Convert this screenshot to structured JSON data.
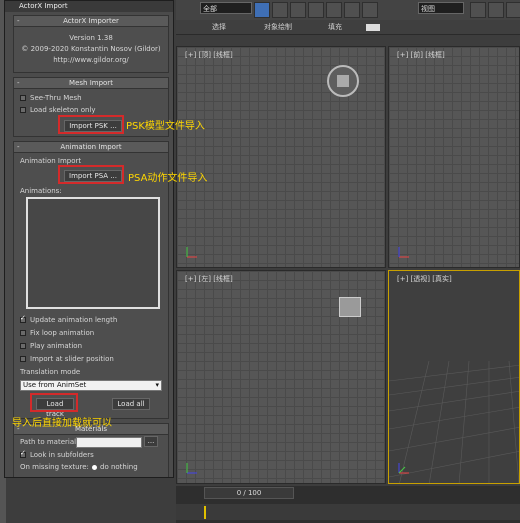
{
  "toolbar": {
    "filter_value": "全部",
    "view_value": "视图"
  },
  "subbar": {
    "tabs": [
      "选择",
      "对象绘制",
      "填充"
    ]
  },
  "viewports": {
    "top": "[+] [顶] [线框]",
    "front": "[+] [前] [线框]",
    "left": "[+] [左] [线框]",
    "perspective": "[+] [透视] [真实]"
  },
  "timeline": {
    "frame": "0 / 100"
  },
  "dialog": {
    "title": "ActorX Import",
    "importer": {
      "header": "ActorX Importer",
      "version": "Version 1.38",
      "copyright": "© 2009-2020 Konstantin Nosov (Gildor)",
      "url": "http://www.gildor.org/"
    },
    "mesh": {
      "header": "Mesh Import",
      "see_thru": "See-Thru Mesh",
      "load_skeleton": "Load skeleton only",
      "import_psk": "Import PSK ..."
    },
    "anim": {
      "header": "Animation Import",
      "subheader": "Animation Import",
      "import_psa": "Import PSA ...",
      "animations_label": "Animations:",
      "update_length": "Update animation length",
      "fix_loop": "Fix loop animation",
      "play_anim": "Play animation",
      "import_at_slider": "Import at slider position",
      "translation_mode": "Translation mode",
      "translation_value": "Use from AnimSet",
      "load_track": "Load track",
      "load_all": "Load all"
    },
    "materials": {
      "header": "Materials",
      "path_label": "Path to materials",
      "browse": "...",
      "look_subfolders": "Look in subfolders",
      "on_missing": "On missing texture:",
      "do_nothing": "do nothing"
    }
  },
  "annotations": {
    "psk": "PSK模型文件导入",
    "psa": "PSA动作文件导入",
    "load": "导入后直接加载就可以"
  },
  "colors": {
    "annotation": "#ffd700",
    "highlight": "#d42a2a",
    "active_viewport": "#c8a000"
  }
}
